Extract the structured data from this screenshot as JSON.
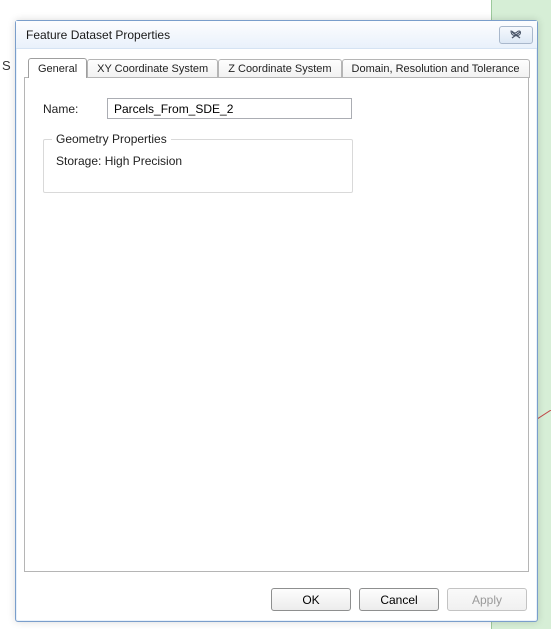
{
  "background": {
    "letter": "S"
  },
  "dialog": {
    "title": "Feature Dataset Properties",
    "tabs": [
      {
        "label": "General",
        "active": true
      },
      {
        "label": "XY Coordinate System",
        "active": false
      },
      {
        "label": "Z Coordinate System",
        "active": false
      },
      {
        "label": "Domain, Resolution and Tolerance",
        "active": false
      }
    ],
    "general": {
      "name_label": "Name:",
      "name_value": "Parcels_From_SDE_2",
      "group_legend": "Geometry Properties",
      "storage_text": "Storage: High Precision"
    },
    "buttons": {
      "ok": "OK",
      "cancel": "Cancel",
      "apply": "Apply",
      "apply_enabled": false
    }
  }
}
